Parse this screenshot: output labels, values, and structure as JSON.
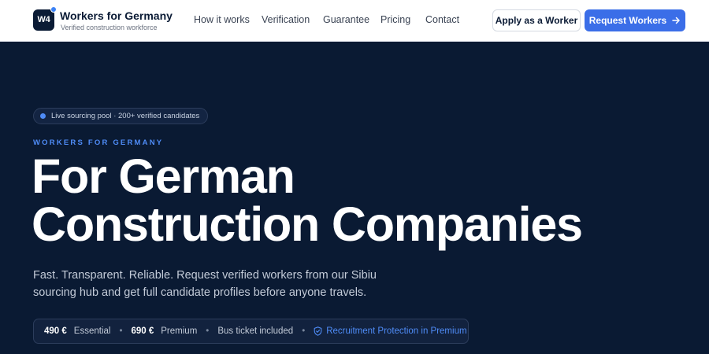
{
  "header": {
    "logo_text": "W4",
    "brand_name": "Workers for Germany",
    "brand_tagline": "Verified construction workforce",
    "nav": [
      {
        "label": "How it works"
      },
      {
        "label": "Verification"
      },
      {
        "label": "Guarantee"
      },
      {
        "label": "Pricing"
      },
      {
        "label": "Contact"
      }
    ],
    "apply_label": "Apply as a Worker",
    "request_label": "Request Workers"
  },
  "hero": {
    "pill_text": "Live sourcing pool · 200+ verified candidates",
    "eyebrow": "WORKERS FOR GERMANY",
    "headline_line1": "For German",
    "headline_line2": "Construction Companies",
    "subtitle": "Fast. Transparent. Reliable. Request verified workers from our Sibiu sourcing hub and get full candidate profiles before anyone travels.",
    "pricing": {
      "essential_price": "490 €",
      "essential_label": "Essential",
      "premium_price": "690 €",
      "premium_label": "Premium",
      "bus_ticket": "Bus ticket included",
      "protection": "Recruitment Protection in Premium"
    }
  },
  "colors": {
    "accent": "#3b6ee8",
    "hero_background": "#0a1a33",
    "header_background": "#ffffff"
  },
  "icons": {
    "request_arrow": "arrow-right-icon",
    "protection": "shield-check-icon",
    "live_indicator": "live-dot-icon"
  }
}
